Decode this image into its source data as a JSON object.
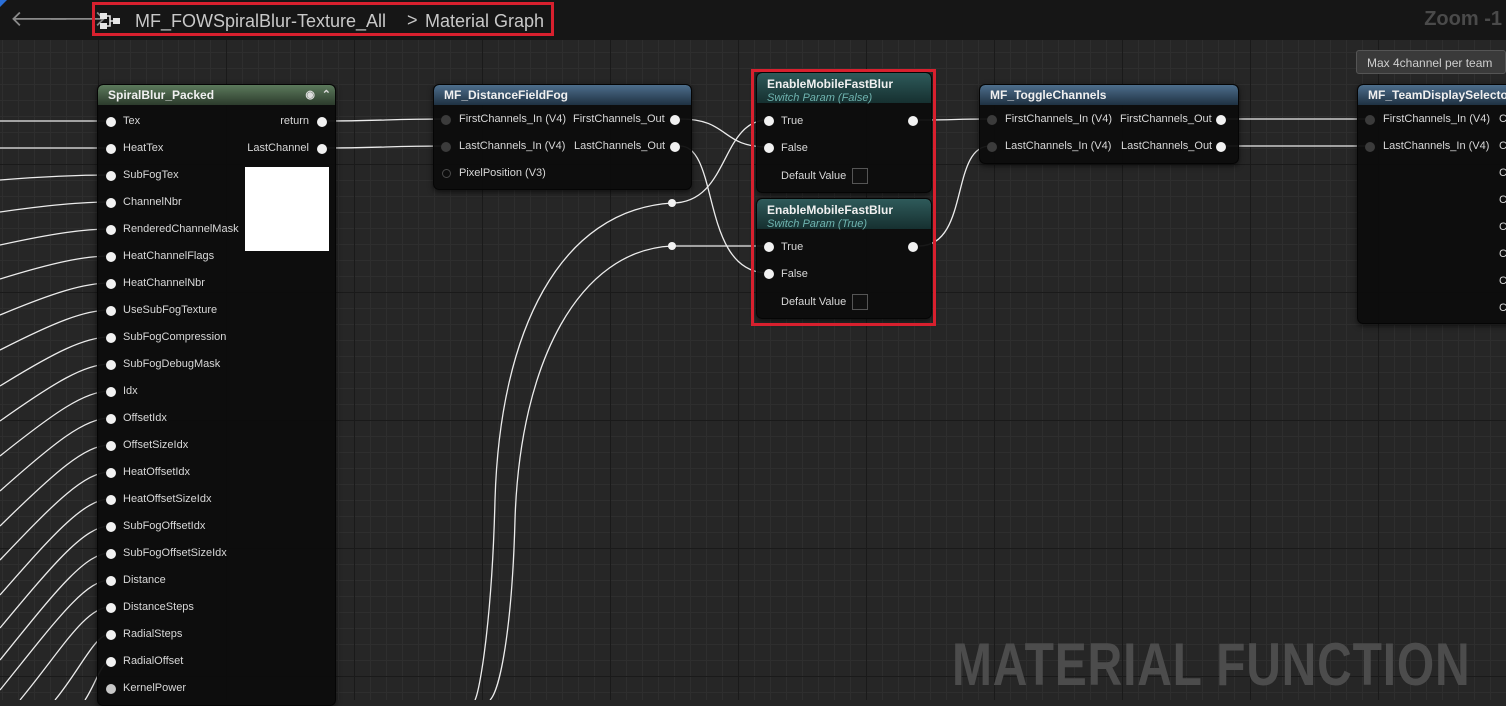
{
  "toolbar": {
    "back_icon": "arrow-left-icon",
    "forward_icon": "arrow-right-icon",
    "breadcrumb_asset": "MF_FOWSpiralBlur-Texture_All",
    "breadcrumb_sep": ">",
    "breadcrumb_graph": "Material Graph",
    "zoom": "Zoom -1"
  },
  "watermark": "MATERIAL FUNCTION",
  "comment": "Max 4channel per team",
  "colors": {
    "highlight": "#d8202e",
    "graph_bg": "#262626"
  },
  "spiral": {
    "title": "SpiralBlur_Packed",
    "inputs": [
      "Tex",
      "HeatTex",
      "SubFogTex",
      "ChannelNbr",
      "RenderedChannelMask",
      "HeatChannelFlags",
      "HeatChannelNbr",
      "UseSubFogTexture",
      "SubFogCompression",
      "SubFogDebugMask",
      "Idx",
      "OffsetIdx",
      "OffsetSizeIdx",
      "HeatOffsetIdx",
      "HeatOffsetSizeIdx",
      "SubFogOffsetIdx",
      "SubFogOffsetSizeIdx",
      "Distance",
      "DistanceSteps",
      "RadialSteps",
      "RadialOffset",
      "KernelPower"
    ],
    "outputs": [
      "return",
      "LastChannel"
    ]
  },
  "fog": {
    "title": "MF_DistanceFieldFog",
    "in1": "FirstChannels_In (V4)",
    "in2": "LastChannels_In (V4)",
    "in3": "PixelPosition (V3)",
    "out1": "FirstChannels_Out",
    "out2": "LastChannels_Out"
  },
  "sw1": {
    "title": "EnableMobileFastBlur",
    "subtitle": "Switch Param (False)",
    "true": "True",
    "false": "False",
    "default": "Default Value"
  },
  "sw2": {
    "title": "EnableMobileFastBlur",
    "subtitle": "Switch Param (True)",
    "true": "True",
    "false": "False",
    "default": "Default Value"
  },
  "toggle": {
    "title": "MF_ToggleChannels",
    "in1": "FirstChannels_In (V4)",
    "in2": "LastChannels_In (V4)",
    "out1": "FirstChannels_Out",
    "out2": "LastChannels_Out"
  },
  "team": {
    "title": "MF_TeamDisplaySelector",
    "in1": "FirstChannels_In (V4)",
    "in2": "LastChannels_In (V4)",
    "cut": "Ch"
  }
}
